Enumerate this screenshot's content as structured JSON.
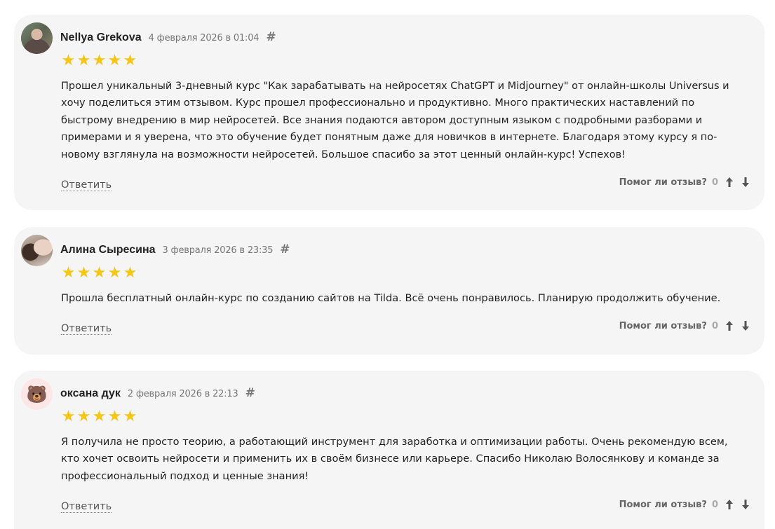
{
  "reviews": [
    {
      "author": "Nellya Grekova",
      "date": "4 февраля 2026 в 01:04",
      "permalink": "#",
      "rating": 5,
      "stars": [
        "★",
        "★",
        "★",
        "★",
        "★"
      ],
      "text": "Прошел уникальный 3-дневный курс \"Как зарабатывать на нейросетях ChatGPT и Midjourney\" от онлайн-школы Universus и хочу поделиться этим отзывом. Курс прошел профессионально и продуктивно. Много практических наставлений по быстрому внедрению в мир нейросетей. Все знания подаются автором доступным языком с подробными разборами и примерами и я уверена, что это обучение будет понятным даже для новичков в интернете. Благодаря этому курсу я по-новому взглянула на возможности нейросетей. Большое спасибо за этот ценный онлайн-курс! Успехов!",
      "reply_label": "Ответить",
      "helpful_label": "Помог ли отзыв?",
      "helpful_count": "0",
      "avatar_icon": "user-photo"
    },
    {
      "author": "Алина Сыресина",
      "date": "3 февраля 2026 в 23:35",
      "permalink": "#",
      "rating": 5,
      "stars": [
        "★",
        "★",
        "★",
        "★",
        "★"
      ],
      "text": "Прошла бесплатный онлайн-курс по созданию сайтов на Tilda. Всё очень понравилось. Планирую продолжить обучение.",
      "reply_label": "Ответить",
      "helpful_label": "Помог ли отзыв?",
      "helpful_count": "0",
      "avatar_icon": "user-photo"
    },
    {
      "author": "оксана дук",
      "date": "2 февраля 2026 в 22:13",
      "permalink": "#",
      "rating": 5,
      "stars": [
        "★",
        "★",
        "★",
        "★",
        "★"
      ],
      "text": "Я получила не просто теорию, а работающий инструмент для заработка и оптимизации работы. Очень рекомендую всем, кто хочет освоить нейросети и применить их в своём бизнесе или карьере. Спасибо Николаю Волосянкову и команде за профессиональный подход и ценные знания!",
      "reply_label": "Ответить",
      "helpful_label": "Помог ли отзыв?",
      "helpful_count": "0",
      "avatar_icon": "bear-emoji",
      "avatar_glyph": "🐻"
    }
  ],
  "colors": {
    "card_background": "#f5f5f5",
    "star": "#f5c518",
    "muted_text": "#777777",
    "body_text": "#222222"
  },
  "icons": {
    "upvote": "arrow-up-icon",
    "downvote": "arrow-down-icon",
    "star": "star-icon",
    "permalink": "hash-icon"
  }
}
